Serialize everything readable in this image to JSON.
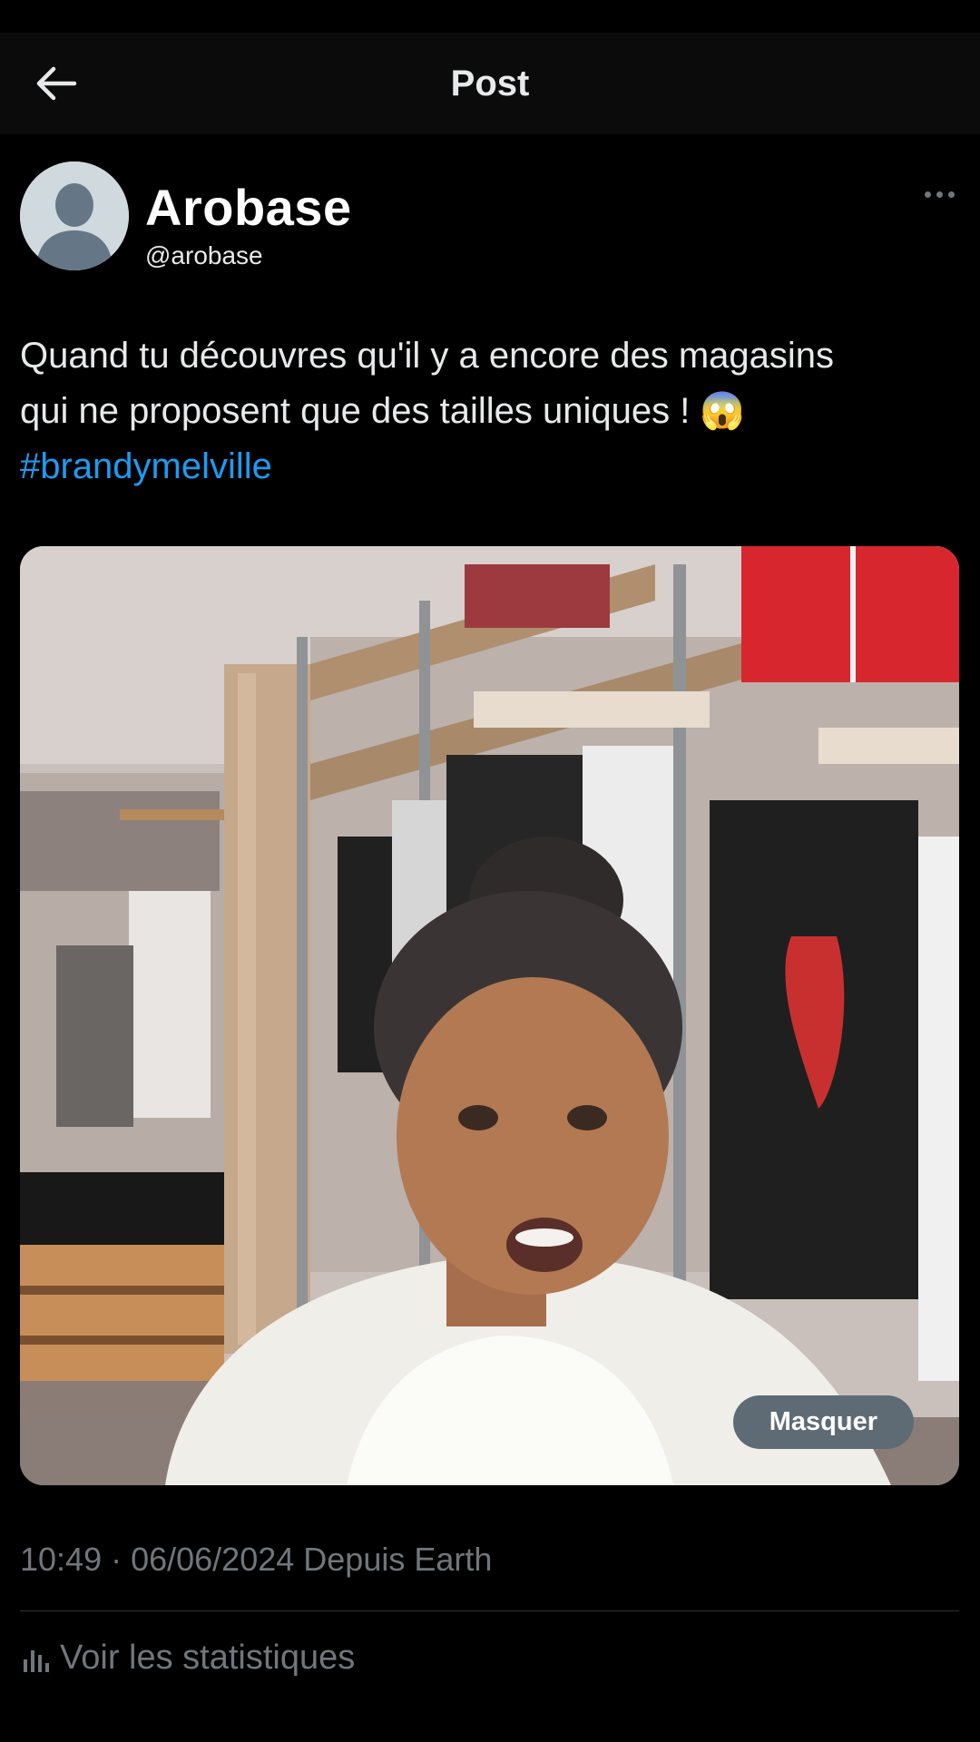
{
  "header": {
    "title": "Post"
  },
  "author": {
    "name": "Arobase",
    "handle": "@arobase"
  },
  "post": {
    "text_line1": "Quand tu découvres qu'il y a encore des magasins",
    "text_line2": "qui ne proposent que des tailles uniques ! 😱",
    "hashtag": "#brandymelville",
    "media_button": "Masquer",
    "timestamp": "10:49 · 06/06/2024",
    "source": "Depuis Earth"
  },
  "footer": {
    "stats_label": "Voir les statistiques"
  },
  "colors": {
    "background": "#000000",
    "text": "#e7e9ea",
    "muted": "#71767b",
    "link": "#1d9bf0"
  },
  "icons": {
    "back": "arrow-left-icon",
    "more": "more-horizontal-icon",
    "stats": "bar-chart-icon"
  }
}
